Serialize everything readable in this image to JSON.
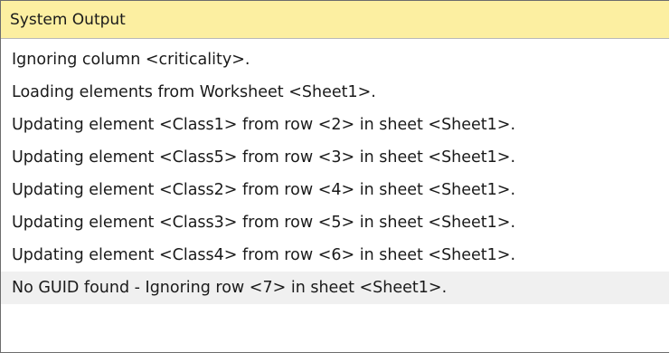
{
  "panel": {
    "title": "System Output"
  },
  "output": {
    "lines": [
      "Ignoring column <criticality>.",
      "Loading elements from Worksheet <Sheet1>.",
      "Updating element <Class1> from row <2> in sheet <Sheet1>.",
      "Updating element <Class5> from row <3> in sheet <Sheet1>.",
      "Updating element <Class2> from row <4> in sheet <Sheet1>.",
      "Updating element <Class3> from row <5> in sheet <Sheet1>.",
      "Updating element <Class4> from row <6> in sheet <Sheet1>.",
      "No GUID found - Ignoring row <7> in sheet <Sheet1>."
    ],
    "selected_index": 7
  },
  "colors": {
    "header_background": "#fcefa1",
    "selected_row": "#f0f0f0",
    "text": "#1a1a1a"
  }
}
